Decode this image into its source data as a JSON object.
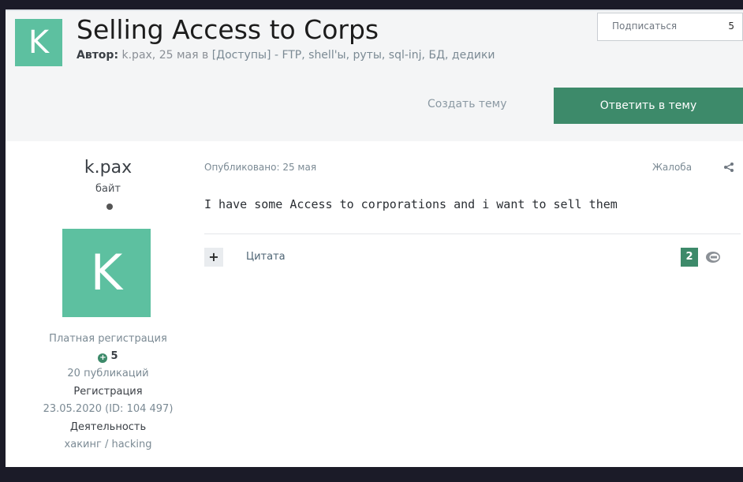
{
  "topic": {
    "avatar_letter": "K",
    "title": "Selling Access to Corps",
    "author_label": "Автор:",
    "author": "k.pax,",
    "date": "25 мая",
    "forum_prefix": "в",
    "forum": "[Доступы] - FTP, shell'ы, руты, sql-inj, БД, дедики"
  },
  "subscribe": {
    "label": "Подписаться",
    "count": "5"
  },
  "actions": {
    "create": "Создать тему",
    "reply": "Ответить в тему"
  },
  "author_panel": {
    "name": "k.pax",
    "rank": "байт",
    "avatar_letter": "K",
    "group": "Платная регистрация",
    "reputation": "5",
    "posts": "20 публикаций",
    "reg_label": "Регистрация",
    "reg_value": "23.05.2020 (ID: 104 497)",
    "activity_label": "Деятельность",
    "activity_value": "хакинг / hacking"
  },
  "post": {
    "published": "Опубликовано: 25 мая",
    "complaint": "Жалоба",
    "text": "I have some Access to corporations  and i want to sell them",
    "quote": "Цитата",
    "reaction_count": "2"
  },
  "colors": {
    "accent": "#3d8a6a",
    "avatar": "#5dc0a0",
    "background": "#1b1b28"
  },
  "icons": {
    "share": "share-icon",
    "reaction": "reaction-icon",
    "status": "status-dot"
  }
}
